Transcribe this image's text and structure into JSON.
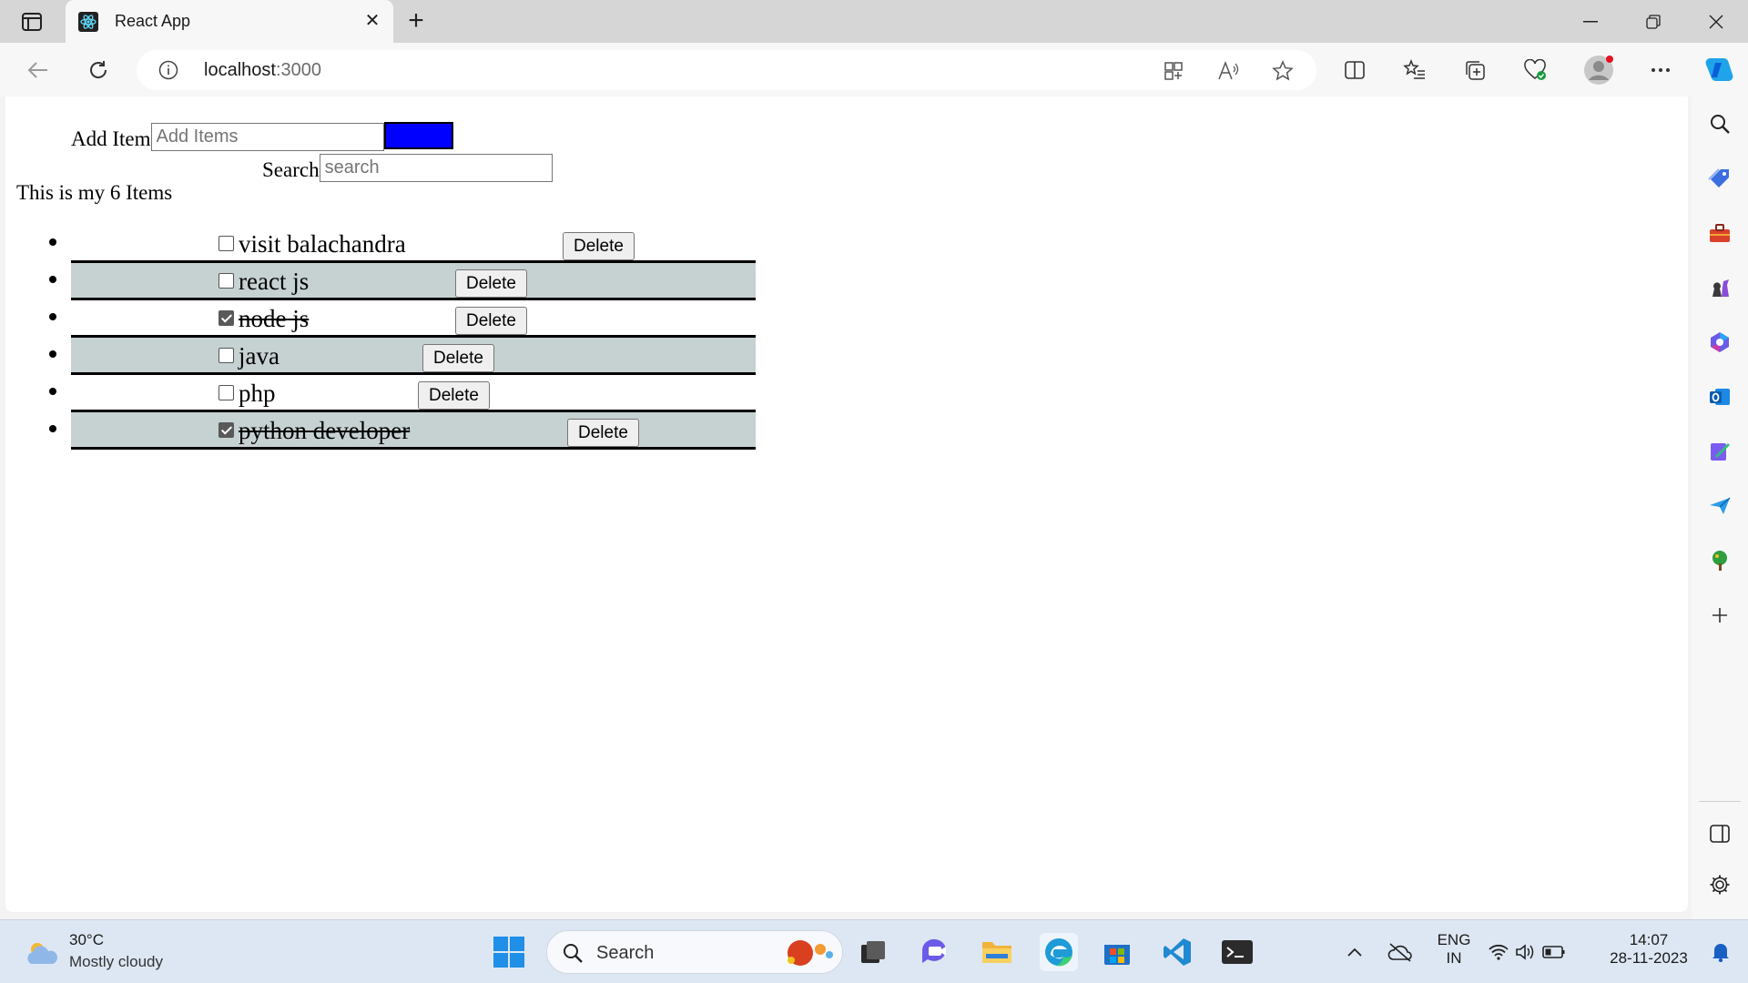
{
  "browser": {
    "tab_title": "React App",
    "url_host": "localhost",
    "url_port": ":3000"
  },
  "app": {
    "add_label": "Add Item",
    "add_placeholder": "Add Items",
    "add_button_color": "#0000ff",
    "search_label": "Search",
    "search_placeholder": "search",
    "count_text": "This is my 6 Items",
    "delete_label": "Delete",
    "items": [
      {
        "text": "visit balachandra",
        "checked": false
      },
      {
        "text": "react js",
        "checked": false
      },
      {
        "text": "node js",
        "checked": true
      },
      {
        "text": "java",
        "checked": false
      },
      {
        "text": "php",
        "checked": false
      },
      {
        "text": "python developer",
        "checked": true
      }
    ],
    "row_shade_color": "#c6d1d2"
  },
  "taskbar": {
    "weather_temp": "30°C",
    "weather_condition": "Mostly cloudy",
    "search_label": "Search",
    "lang_top": "ENG",
    "lang_bottom": "IN",
    "time": "14:07",
    "date": "28-11-2023"
  }
}
